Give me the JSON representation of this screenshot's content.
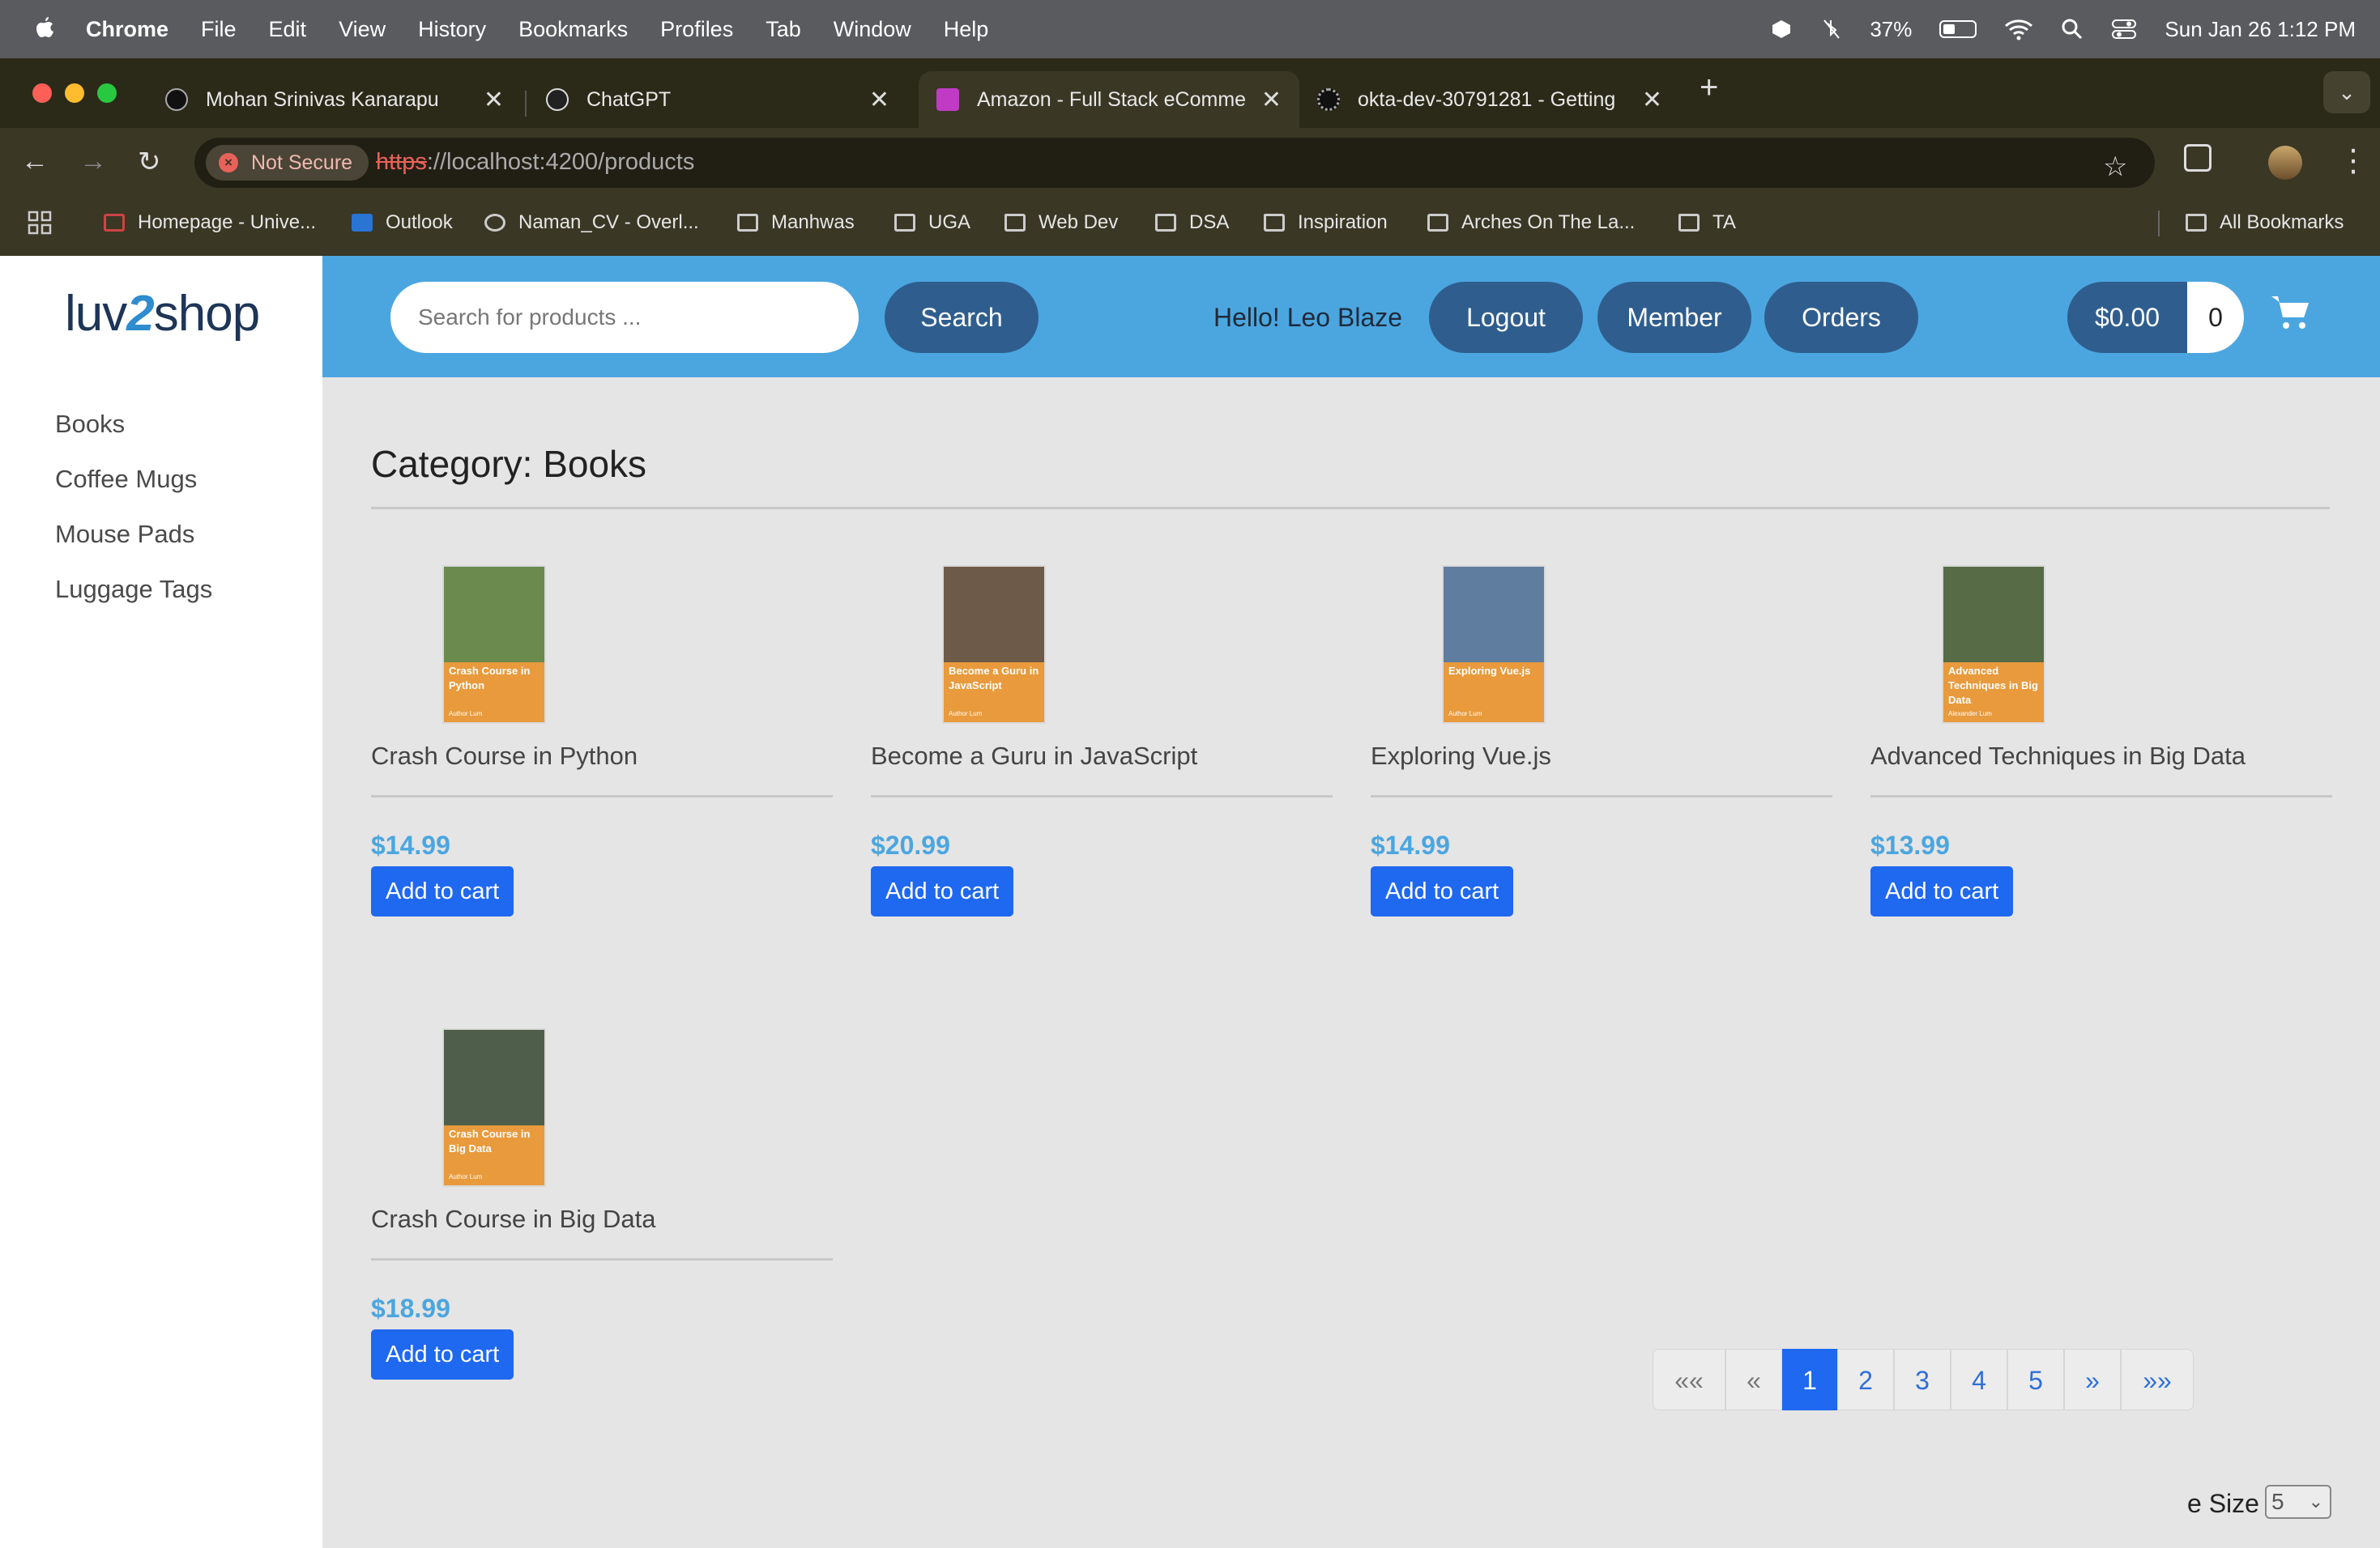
{
  "os_menubar": {
    "app_name": "Chrome",
    "menus": [
      "File",
      "Edit",
      "View",
      "History",
      "Bookmarks",
      "Profiles",
      "Tab",
      "Window",
      "Help"
    ],
    "battery_percent": "37%",
    "datetime": "Sun Jan 26  1:12 PM"
  },
  "browser": {
    "tabs": [
      {
        "title": "Mohan Srinivas Kanarapu",
        "active": false
      },
      {
        "title": "ChatGPT",
        "active": false
      },
      {
        "title": "Amazon - Full Stack eComme",
        "active": true
      },
      {
        "title": "okta-dev-30791281 - Getting",
        "active": false
      }
    ],
    "security_label": "Not Secure",
    "url": {
      "scheme": "https",
      "rest": "://localhost:4200/products"
    },
    "bookmarks": [
      {
        "label": "Homepage - Unive...",
        "icon": "page-icon"
      },
      {
        "label": "Outlook",
        "icon": "outlook-icon"
      },
      {
        "label": "Naman_CV - Overl...",
        "icon": "overleaf-icon"
      },
      {
        "label": "Manhwas",
        "icon": "folder-icon"
      },
      {
        "label": "UGA",
        "icon": "folder-icon"
      },
      {
        "label": "Web Dev",
        "icon": "folder-icon"
      },
      {
        "label": "DSA",
        "icon": "folder-icon"
      },
      {
        "label": "Inspiration",
        "icon": "folder-icon"
      },
      {
        "label": "Arches On The La...",
        "icon": "page-icon"
      },
      {
        "label": "TA",
        "icon": "folder-icon"
      }
    ],
    "all_bookmarks_label": "All Bookmarks"
  },
  "store": {
    "logo": {
      "part1": "luv",
      "part2": "2",
      "part3": "shop"
    },
    "search": {
      "placeholder": "Search for products ...",
      "button": "Search"
    },
    "greeting": "Hello! Leo Blaze",
    "nav_buttons": {
      "logout": "Logout",
      "member": "Member",
      "orders": "Orders"
    },
    "cart": {
      "total": "$0.00",
      "quantity": "0"
    },
    "categories": [
      "Books",
      "Coffee Mugs",
      "Mouse Pads",
      "Luggage Tags"
    ],
    "category_heading": "Category: Books",
    "add_to_cart_label": "Add to cart",
    "products": [
      {
        "name": "Crash Course in Python",
        "price": "$14.99",
        "cover_title": "Crash Course in Python",
        "cover_author": "Author Lum",
        "cover_photo_color": "#6b8a4e"
      },
      {
        "name": "Become a Guru in JavaScript",
        "price": "$20.99",
        "cover_title": "Become a Guru in JavaScript",
        "cover_author": "Author Lum",
        "cover_photo_color": "#6e5a48"
      },
      {
        "name": "Exploring Vue.js",
        "price": "$14.99",
        "cover_title": "Exploring Vue.js",
        "cover_author": "Author Lum",
        "cover_photo_color": "#5f7d9e"
      },
      {
        "name": "Advanced Techniques in Big Data",
        "price": "$13.99",
        "cover_title": "Advanced Techniques in Big Data",
        "cover_author": "Alexander Lum",
        "cover_photo_color": "#566b46"
      },
      {
        "name": "Crash Course in Big Data",
        "price": "$18.99",
        "cover_title": "Crash Course in Big Data",
        "cover_author": "Author Lum",
        "cover_photo_color": "#4e5e4a"
      }
    ],
    "pagination": {
      "first": "««",
      "prev": "«",
      "pages": [
        "1",
        "2",
        "3",
        "4",
        "5"
      ],
      "current": "1",
      "next": "»",
      "last": "»»"
    },
    "page_size": {
      "label": "e Size",
      "value": "5"
    }
  }
}
